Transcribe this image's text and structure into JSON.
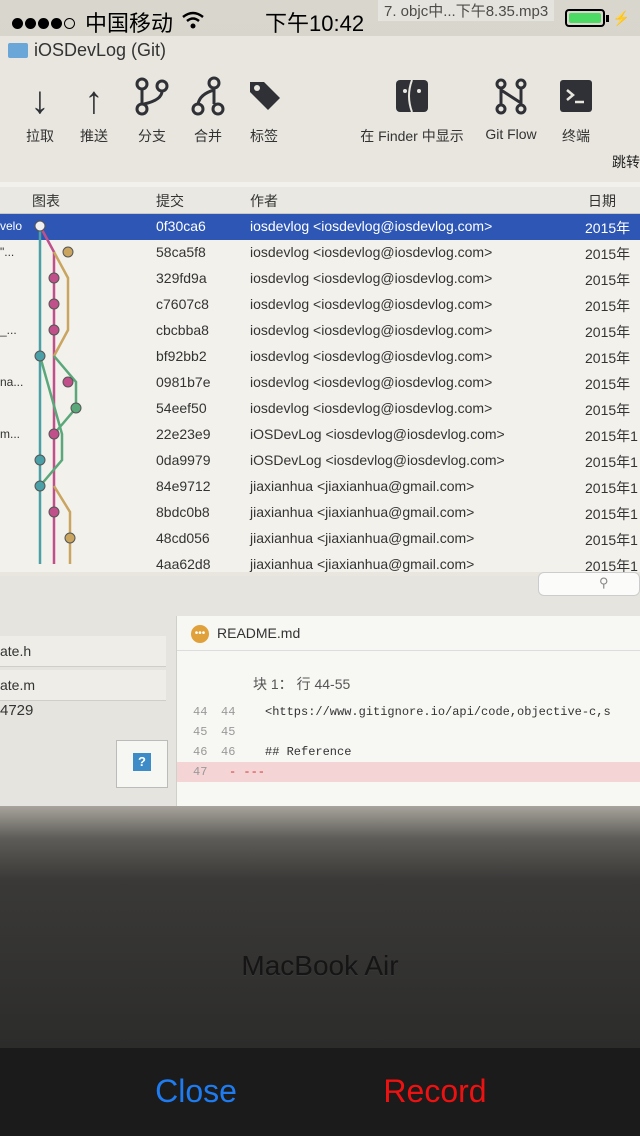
{
  "status_bar": {
    "carrier": "中国移动",
    "time": "下午10:42",
    "overlay_text": "7. objc中...下午8.35.mp3",
    "battery_level": 1.0
  },
  "window": {
    "title": "iOSDevLog (Git)",
    "toolbar": [
      {
        "label": "拉取",
        "icon": "pull-icon"
      },
      {
        "label": "推送",
        "icon": "push-icon"
      },
      {
        "label": "分支",
        "icon": "branch-icon"
      },
      {
        "label": "合并",
        "icon": "merge-icon"
      },
      {
        "label": "标签",
        "icon": "tag-icon"
      },
      {
        "label": "在 Finder 中显示",
        "icon": "finder-icon"
      },
      {
        "label": "Git Flow",
        "icon": "gitflow-icon"
      },
      {
        "label": "终端",
        "icon": "terminal-icon"
      }
    ],
    "jump_label": "跳转",
    "columns": {
      "graph": "图表",
      "commit": "提交",
      "author": "作者",
      "date": "日期"
    },
    "commits": [
      {
        "c1": "velo",
        "hash": "0f30ca6",
        "author": "iosdevlog <iosdevlog@iosdevlog.com>",
        "date": "2015年",
        "selected": true
      },
      {
        "c1": "\"...",
        "hash": "58ca5f8",
        "author": "iosdevlog <iosdevlog@iosdevlog.com>",
        "date": "2015年"
      },
      {
        "c1": "",
        "hash": "329fd9a",
        "author": "iosdevlog <iosdevlog@iosdevlog.com>",
        "date": "2015年"
      },
      {
        "c1": "",
        "hash": "c7607c8",
        "author": "iosdevlog <iosdevlog@iosdevlog.com>",
        "date": "2015年"
      },
      {
        "c1": "_...",
        "hash": "cbcbba8",
        "author": "iosdevlog <iosdevlog@iosdevlog.com>",
        "date": "2015年"
      },
      {
        "c1": "",
        "hash": "bf92bb2",
        "author": "iosdevlog <iosdevlog@iosdevlog.com>",
        "date": "2015年"
      },
      {
        "c1": "na...",
        "hash": "0981b7e",
        "author": "iosdevlog <iosdevlog@iosdevlog.com>",
        "date": "2015年"
      },
      {
        "c1": "",
        "hash": "54eef50",
        "author": "iosdevlog <iosdevlog@iosdevlog.com>",
        "date": "2015年"
      },
      {
        "c1": "m...",
        "hash": "22e23e9",
        "author": "iOSDevLog <iosdevlog@iosdevlog.com>",
        "date": "2015年1"
      },
      {
        "c1": "",
        "hash": "0da9979",
        "author": "iOSDevLog <iosdevlog@iosdevlog.com>",
        "date": "2015年1"
      },
      {
        "c1": "",
        "hash": "84e9712",
        "author": "jiaxianhua <jiaxianhua@gmail.com>",
        "date": "2015年1"
      },
      {
        "c1": "",
        "hash": "8bdc0b8",
        "author": "jiaxianhua <jiaxianhua@gmail.com>",
        "date": "2015年1"
      },
      {
        "c1": "",
        "hash": "48cd056",
        "author": "jiaxianhua <jiaxianhua@gmail.com>",
        "date": "2015年1"
      },
      {
        "c1": "",
        "hash": "4aa62d8",
        "author": "jiaxianhua <jiaxianhua@gmail.com>",
        "date": "2015年1"
      }
    ],
    "files": [
      "ate.h",
      "ate.m"
    ],
    "file_partial": "4729",
    "diff": {
      "filename": "README.md",
      "hunk_header": "块 1： 行 44-55",
      "lines": [
        {
          "old": "44",
          "new": "44",
          "code": "<https://www.gitignore.io/api/code,objective-c,s",
          "type": "ctx"
        },
        {
          "old": "45",
          "new": "45",
          "code": "",
          "type": "ctx"
        },
        {
          "old": "46",
          "new": "46",
          "code": "## Reference",
          "type": "ctx"
        },
        {
          "old": "47",
          "new": "",
          "code": "- ---",
          "type": "del"
        }
      ]
    }
  },
  "bezel_label": "MacBook Air",
  "bottom_bar": {
    "close_label": "Close",
    "record_label": "Record",
    "close_color": "#1e7bf0",
    "record_color": "#ee1111"
  }
}
